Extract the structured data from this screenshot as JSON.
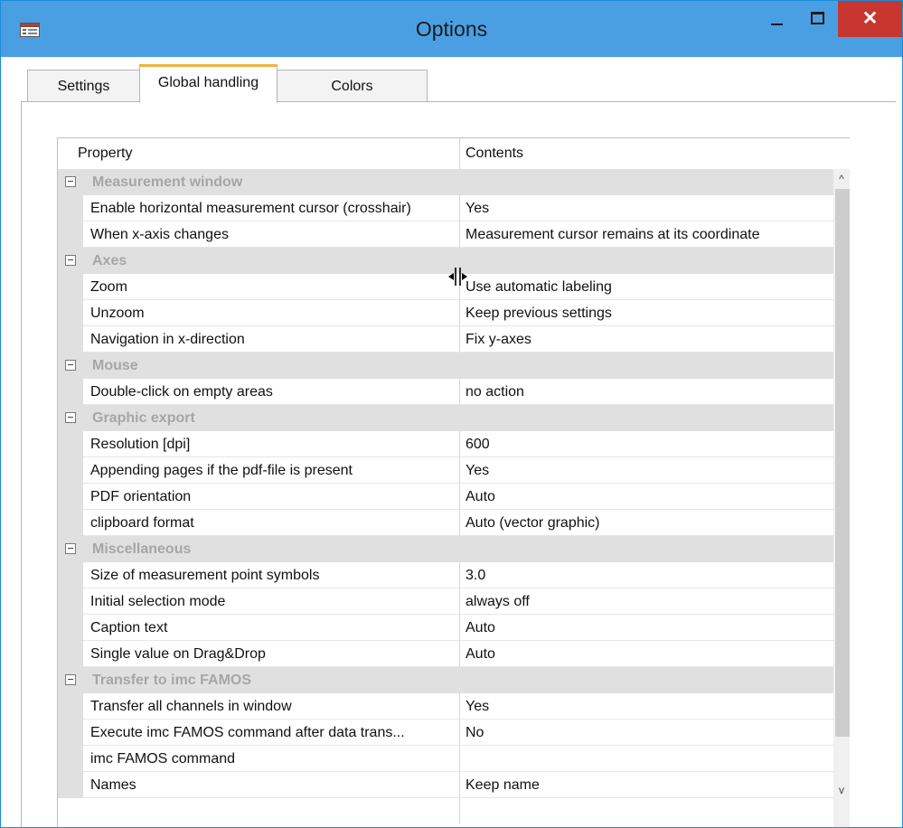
{
  "window": {
    "title": "Options",
    "close_glyph": "✕",
    "icons": {
      "app": "options-window-icon",
      "minimize": "minimize-icon",
      "maximize": "maximize-icon",
      "close": "close-icon"
    },
    "colors": {
      "titlebar": "#4a9fe3",
      "close": "#c7372f",
      "active_tab_accent": "#f0b33a"
    }
  },
  "tabs": [
    {
      "label": "Settings",
      "active": false
    },
    {
      "label": "Global handling",
      "active": true
    },
    {
      "label": "Colors",
      "active": false
    }
  ],
  "grid": {
    "headers": {
      "property": "Property",
      "contents": "Contents"
    },
    "rows": [
      {
        "type": "category",
        "label": "Measurement window"
      },
      {
        "type": "property",
        "name": "Enable horizontal measurement cursor (crosshair)",
        "value": "Yes"
      },
      {
        "type": "property",
        "name": "When x-axis changes",
        "value": "Measurement cursor remains at its coordinate"
      },
      {
        "type": "category",
        "label": "Axes"
      },
      {
        "type": "property",
        "name": "Zoom",
        "value": "Use automatic labeling"
      },
      {
        "type": "property",
        "name": "Unzoom",
        "value": "Keep previous settings"
      },
      {
        "type": "property",
        "name": "Navigation in x-direction",
        "value": "Fix y-axes"
      },
      {
        "type": "category",
        "label": "Mouse"
      },
      {
        "type": "property",
        "name": "Double-click on empty areas",
        "value": "no action"
      },
      {
        "type": "category",
        "label": "Graphic export"
      },
      {
        "type": "property",
        "name": "Resolution [dpi]",
        "value": "600"
      },
      {
        "type": "property",
        "name": "Appending pages if the pdf-file is present",
        "value": "Yes"
      },
      {
        "type": "property",
        "name": "PDF orientation",
        "value": "Auto"
      },
      {
        "type": "property",
        "name": "clipboard format",
        "value": "Auto (vector graphic)"
      },
      {
        "type": "category",
        "label": "Miscellaneous"
      },
      {
        "type": "property",
        "name": "Size of measurement point symbols",
        "value": "3.0"
      },
      {
        "type": "property",
        "name": "Initial selection mode",
        "value": "always off"
      },
      {
        "type": "property",
        "name": "Caption text",
        "value": "Auto"
      },
      {
        "type": "property",
        "name": "Single value on Drag&Drop",
        "value": "Auto"
      },
      {
        "type": "category",
        "label": "Transfer to imc FAMOS"
      },
      {
        "type": "property",
        "name": "Transfer all channels in window",
        "value": "Yes"
      },
      {
        "type": "property",
        "name": "Execute imc FAMOS command after data trans...",
        "value": "No"
      },
      {
        "type": "property",
        "name": "imc FAMOS command",
        "value": ""
      },
      {
        "type": "property",
        "name": "Names",
        "value": "Keep name"
      }
    ],
    "scroll_up_glyph": "^",
    "scroll_down_glyph": "v"
  }
}
